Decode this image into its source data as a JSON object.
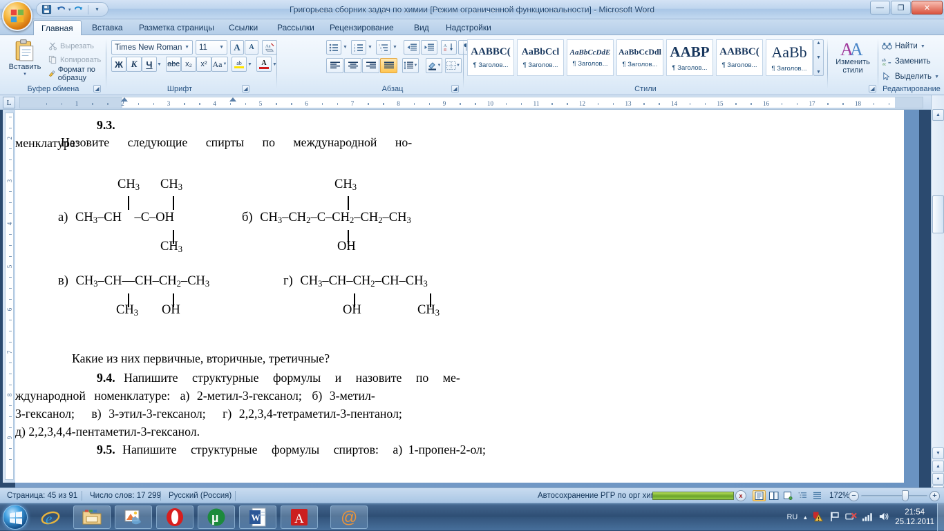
{
  "window": {
    "title": "Григорьева сборник задач по химии [Режим ограниченной функциональности] - Microsoft Word",
    "minimize": "—",
    "maximize": "❐",
    "close": "✕"
  },
  "quick_access": {
    "save": "save-icon",
    "undo": "undo-icon",
    "redo": "redo-icon",
    "customize": "customize-icon"
  },
  "tabs": [
    {
      "label": "Главная",
      "active": true
    },
    {
      "label": "Вставка",
      "active": false
    },
    {
      "label": "Разметка страницы",
      "active": false
    },
    {
      "label": "Ссылки",
      "active": false
    },
    {
      "label": "Рассылки",
      "active": false
    },
    {
      "label": "Рецензирование",
      "active": false
    },
    {
      "label": "Вид",
      "active": false
    },
    {
      "label": "Надстройки",
      "active": false
    }
  ],
  "ribbon": {
    "clipboard": {
      "group_label": "Буфер обмена",
      "paste": "Вставить",
      "cut": "Вырезать",
      "copy": "Копировать",
      "format_painter": "Формат по образцу"
    },
    "font": {
      "group_label": "Шрифт",
      "font_name": "Times New Roman",
      "font_size": "11",
      "grow_font": "A",
      "shrink_font": "A",
      "clear_format": "clear-formatting-icon",
      "bold": "Ж",
      "italic": "К",
      "underline": "Ч",
      "strikethrough": "abc",
      "subscript": "x₂",
      "superscript": "x²",
      "change_case": "Aa",
      "highlight": "ab",
      "font_color": "A"
    },
    "paragraph": {
      "group_label": "Абзац",
      "bullets": "bullet-list-icon",
      "numbering": "numbered-list-icon",
      "multilevel": "multilevel-list-icon",
      "decrease_indent": "decrease-indent-icon",
      "increase_indent": "increase-indent-icon",
      "sort": "sort-icon",
      "show_marks": "¶",
      "align_left": "align-left-icon",
      "align_center": "align-center-icon",
      "align_right": "align-right-icon",
      "align_justify": "align-justify-icon",
      "line_spacing": "line-spacing-icon",
      "shading": "shading-icon",
      "borders": "borders-icon"
    },
    "styles": {
      "group_label": "Стили",
      "items": [
        {
          "sample": "AABBC(",
          "name": "¶ Заголов...",
          "style": "bold"
        },
        {
          "sample": "AaBbCcl",
          "name": "¶ Заголов...",
          "style": "bold"
        },
        {
          "sample": "AaBbCcDdE",
          "name": "¶ Заголов...",
          "style": "italic-small"
        },
        {
          "sample": "AaBbCcDdl",
          "name": "¶ Заголов...",
          "style": "bold-small"
        },
        {
          "sample": "AABP",
          "name": "¶ Заголов...",
          "style": "bold-large"
        },
        {
          "sample": "AABBC(",
          "name": "¶ Заголов...",
          "style": "bold-compact"
        },
        {
          "sample": "AaBb",
          "name": "¶ Заголов...",
          "style": "regular-large"
        }
      ]
    },
    "change_styles": {
      "label_line1": "Изменить",
      "label_line2": "стили"
    },
    "editing": {
      "group_label": "Редактирование",
      "find": "Найти",
      "replace": "Заменить",
      "select": "Выделить"
    }
  },
  "ruler": {
    "tab_stop": "L",
    "horizontal_ticks": [
      "1",
      "2",
      "3",
      "4",
      "5",
      "6",
      "7",
      "8",
      "9",
      "10",
      "11",
      "12",
      "13",
      "14",
      "15",
      "16",
      "17",
      "18"
    ],
    "vertical_ticks": [
      "2",
      "3",
      "4",
      "5",
      "6",
      "7",
      "8",
      "9"
    ]
  },
  "document": {
    "clipped_top_line": "",
    "task_9_3": {
      "number": "9.3.",
      "line1_words": [
        "Назовите",
        "следующие",
        "спирты",
        "по",
        "международной",
        "но-"
      ],
      "line2": "менклатуре:"
    },
    "structures": [
      {
        "letter": "а)",
        "top_branches": [
          "CH3",
          "CH3"
        ],
        "main_chain": "CH3–CH–C–OH",
        "bottom_branches": [
          "CH3"
        ]
      },
      {
        "letter": "б)",
        "top_branches": [
          "CH3"
        ],
        "main_chain": "CH3–CH2–C–CH2–CH2–CH3",
        "bottom_branches": [
          "OH"
        ]
      },
      {
        "letter": "в)",
        "main_chain": "CH3–CH—CH–CH2–CH3",
        "bottom_branches": [
          "CH3",
          "OH"
        ]
      },
      {
        "letter": "г)",
        "main_chain": "CH3–CH–CH2–CH–CH3",
        "bottom_branches": [
          "OH",
          "CH3"
        ]
      }
    ],
    "question_line": "Какие из них первичные, вторичные, третичные?",
    "task_9_4": {
      "number": "9.4.",
      "line1_words": [
        "Напишите",
        "структурные",
        "формулы",
        "и",
        "назовите",
        "по",
        "ме-"
      ],
      "line2_words": [
        "ждународной",
        "номенклатуре:",
        "а)",
        "2-метил-3-гексанол;",
        "б)",
        "3-метил-"
      ],
      "line3_words": [
        "3-гексанол;",
        "в)",
        "3-этил-3-гексанол;",
        "г)",
        "2,2,3,4-тетраметил-3-пентанол;"
      ],
      "line4": "д) 2,2,3,4,4-пентаметил-3-гексанол."
    },
    "task_9_5": {
      "number": "9.5.",
      "line1_words": [
        "Напишите",
        "структурные",
        "формулы",
        "спиртов:",
        "а)",
        "1-пропен-2-ол;"
      ]
    }
  },
  "status_bar": {
    "page": "Страница: 45 из 91",
    "words": "Число слов: 17 299",
    "language": "Русский (Россия)",
    "autosave": "Автосохранение РГР по орг химии:",
    "autosave_cancel": "x",
    "zoom": "172%",
    "zoom_out": "−",
    "zoom_in": "+",
    "view_buttons": [
      "print-layout-icon",
      "full-screen-reading-icon",
      "web-layout-icon",
      "outline-icon",
      "draft-icon"
    ]
  },
  "taskbar": {
    "start": "start-orb-icon",
    "items": [
      {
        "name": "internet-explorer-icon"
      },
      {
        "name": "windows-explorer-icon"
      },
      {
        "name": "picture-manager-icon"
      },
      {
        "name": "opera-icon"
      },
      {
        "name": "utorrent-icon"
      },
      {
        "name": "word-icon"
      },
      {
        "name": "adobe-reader-icon"
      },
      {
        "name": "mail-at-icon"
      }
    ],
    "tray": {
      "language": "RU",
      "show_hidden": "▲",
      "icons": [
        "antivirus-warning-icon",
        "flag-action-center-icon",
        "network-disconnected-icon",
        "signal-icon",
        "volume-icon"
      ],
      "time": "21:54",
      "date": "25.12.2011"
    }
  },
  "colors": {
    "accent": "#1f4e79",
    "ribbon_bg": "#e6f0fa",
    "title_text": "#20456e",
    "highlight": "#ffc551",
    "autosave_green": "#6aa32b"
  }
}
